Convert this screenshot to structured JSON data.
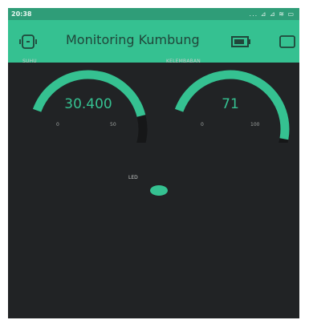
{
  "status_bar": {
    "time": "20:38",
    "icons": "... ⊿ ⊿ ≋ ▭"
  },
  "app_bar": {
    "title": "Monitoring Kumbung",
    "left_icon": "device-icon",
    "right_icons": [
      "battery-icon",
      "square-icon"
    ]
  },
  "gauges": [
    {
      "label": "SUHU",
      "value": "30.400",
      "min": "0",
      "max": "50",
      "fraction": 0.608
    },
    {
      "label": "KELEMBABAN",
      "value": "71",
      "min": "0",
      "max": "100",
      "fraction": 0.71
    }
  ],
  "led": {
    "label": "LED",
    "state": "on"
  },
  "colors": {
    "accent": "#35c191",
    "background": "#212325",
    "track": "#161718"
  }
}
